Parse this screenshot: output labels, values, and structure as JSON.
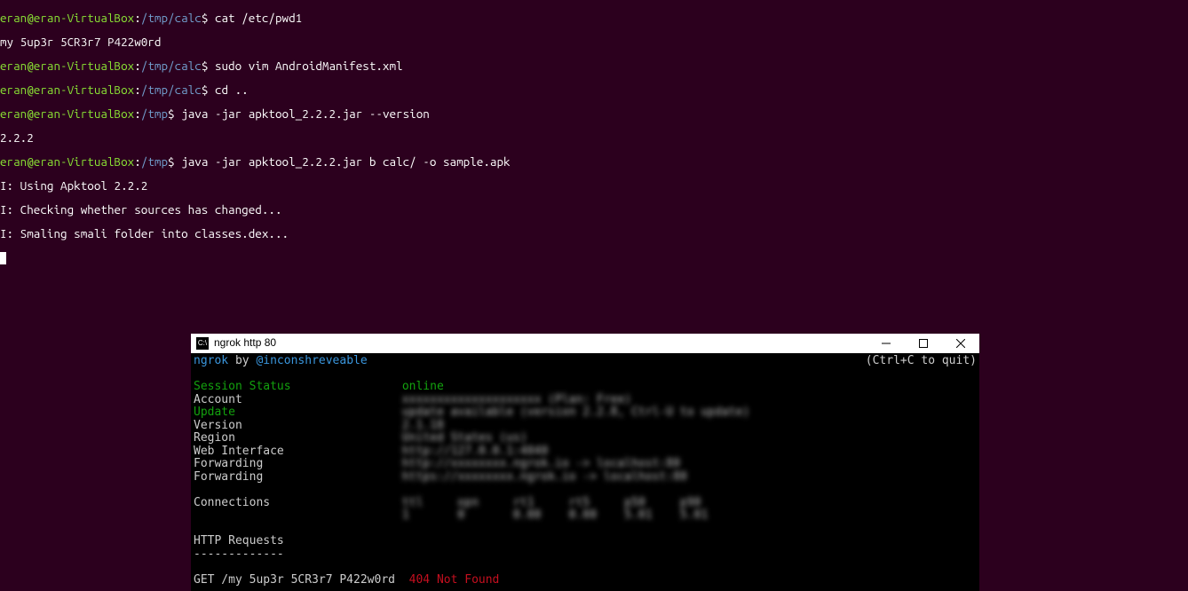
{
  "terminal": {
    "user": "eran@eran-VirtualBox",
    "path_tmp_calc": "/tmp/calc",
    "path_tmp": "/tmp",
    "cmd_cat": "cat /etc/pwd1",
    "out_pwd": "my 5up3r 5CR3r7 P422w0rd",
    "cmd_sudo": "sudo vim AndroidManifest.xml",
    "cmd_cd": "cd ..",
    "cmd_java_ver": "java -jar apktool_2.2.2.jar --version",
    "out_ver": "2.2.2",
    "cmd_java_build": "java -jar apktool_2.2.2.jar b calc/ -o sample.apk",
    "out_build_1": "I: Using Apktool 2.2.2",
    "out_build_2": "I: Checking whether sources has changed...",
    "out_build_3": "I: Smaling smali folder into classes.dex..."
  },
  "ngrok": {
    "title": "ngrok  http  80",
    "head_left": "ngrok",
    "head_by": " by ",
    "head_author": "@inconshreveable",
    "head_right": "(Ctrl+C to quit)",
    "labels": {
      "session": "Session Status",
      "account": "Account",
      "update": "Update",
      "version": "Version",
      "region": "Region",
      "web": "Web Interface",
      "fwd1": "Forwarding",
      "fwd2": "Forwarding",
      "conn": "Connections",
      "http": "HTTP Requests",
      "dash": "-------------"
    },
    "values": {
      "session": "online",
      "account_blur": "xxxxxxxxxxxxxxxxxxxx (Plan: Free)",
      "update_blur": "update available (version 2.2.8, Ctrl-U to update)",
      "version_blur": "2.1.18",
      "region_blur": "United States (us)",
      "web_blur": "http://127.0.0.1:4040",
      "fwd1_blur": "http://xxxxxxxx.ngrok.io -> localhost:80",
      "fwd2_blur": "https://xxxxxxxx.ngrok.io -> localhost:80",
      "conn_hdr_blur": "ttl     opn     rt1     rt5     p50     p90",
      "conn_val_blur": "1       0       0.00    0.00    5.01    5.01"
    },
    "request": {
      "method_path": "GET /my 5up3r 5CR3r7 P422w0rd  ",
      "status": "404 Not Found"
    }
  }
}
